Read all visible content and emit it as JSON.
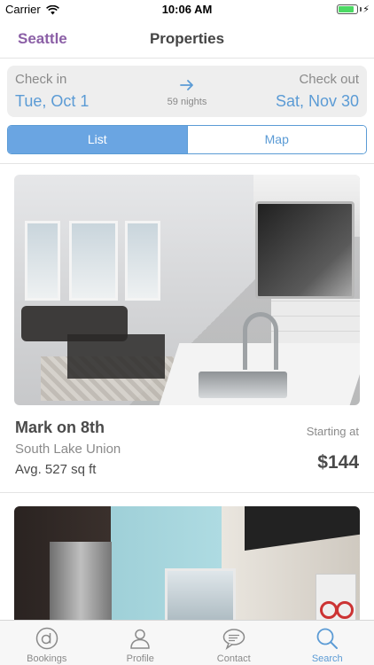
{
  "status_bar": {
    "carrier": "Carrier",
    "time": "10:06 AM",
    "battery_level": 0.85,
    "charging_icon": "bolt-icon"
  },
  "nav": {
    "back_label": "Seattle",
    "title": "Properties"
  },
  "dates": {
    "checkin_label": "Check in",
    "checkin_value": "Tue, Oct 1",
    "checkout_label": "Check out",
    "checkout_value": "Sat, Nov 30",
    "nights": "59 nights",
    "arrow_icon": "arrow-right-icon"
  },
  "segments": {
    "list": "List",
    "map": "Map",
    "selected": "List"
  },
  "listings": [
    {
      "name": "Mark on 8th",
      "area": "South Lake Union",
      "size": "Avg. 527 sq ft",
      "starting_label": "Starting at",
      "price": "$144"
    }
  ],
  "tabs": [
    {
      "label": "Bookings",
      "icon": "bookings-icon"
    },
    {
      "label": "Profile",
      "icon": "person-icon"
    },
    {
      "label": "Contact",
      "icon": "chat-icon"
    },
    {
      "label": "Search",
      "icon": "search-icon",
      "active": true
    }
  ],
  "colors": {
    "accent_blue": "#5b9bd5",
    "accent_purple": "#8b5fa6",
    "battery_green": "#4cd964"
  }
}
